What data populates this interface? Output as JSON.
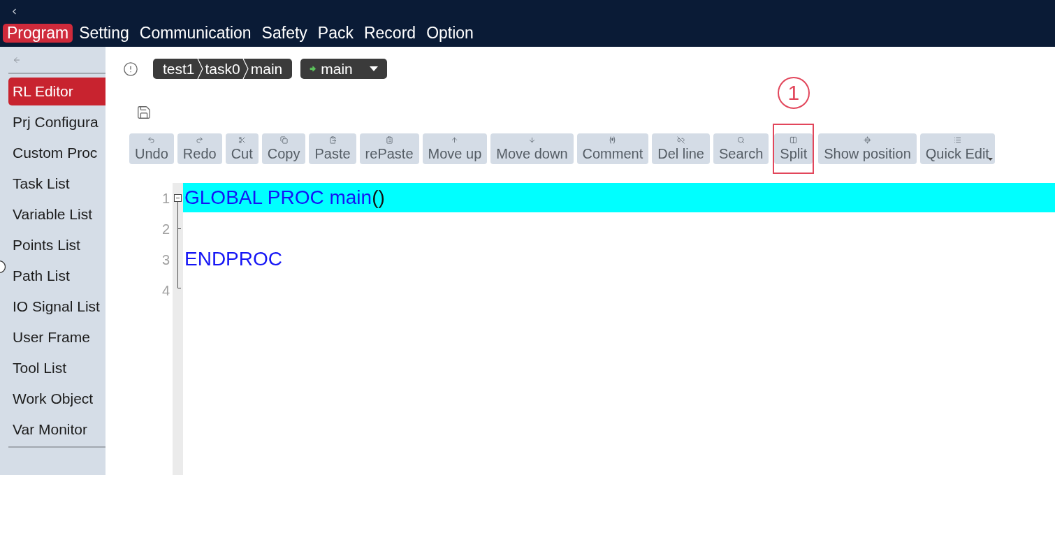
{
  "menu": [
    {
      "label": "Program",
      "selected": true
    },
    {
      "label": "Setting",
      "selected": false
    },
    {
      "label": "Communication",
      "selected": false
    },
    {
      "label": "Safety",
      "selected": false
    },
    {
      "label": "Pack",
      "selected": false
    },
    {
      "label": "Record",
      "selected": false
    },
    {
      "label": "Option",
      "selected": false
    }
  ],
  "sidebar": {
    "items": [
      {
        "label": "RL Editor",
        "selected": true
      },
      {
        "label": "Prj Configura",
        "selected": false
      },
      {
        "label": "Custom Proc",
        "selected": false
      },
      {
        "label": "Task List",
        "selected": false
      },
      {
        "label": "Variable List",
        "selected": false
      },
      {
        "label": "Points List",
        "selected": false
      },
      {
        "label": "Path List",
        "selected": false
      },
      {
        "label": "IO Signal List",
        "selected": false
      },
      {
        "label": "User Frame",
        "selected": false
      },
      {
        "label": "Tool List",
        "selected": false
      },
      {
        "label": "Work Object",
        "selected": false
      },
      {
        "label": "Var Monitor",
        "selected": false
      }
    ]
  },
  "breadcrumb": {
    "segments": [
      "test1",
      "task0",
      "main"
    ]
  },
  "routine_selector": {
    "value": "main"
  },
  "toolbar": [
    {
      "label": "Undo",
      "kind": "undo"
    },
    {
      "label": "Redo",
      "kind": "redo"
    },
    {
      "label": "Cut",
      "kind": "cut"
    },
    {
      "label": "Copy",
      "kind": "copy"
    },
    {
      "label": "Paste",
      "kind": "paste"
    },
    {
      "label": "rePaste",
      "kind": "repaste"
    },
    {
      "label": "Move up",
      "kind": "move-up"
    },
    {
      "label": "Move down",
      "kind": "move-down"
    },
    {
      "label": "Comment",
      "kind": "comment"
    },
    {
      "label": "Del line",
      "kind": "delete-line"
    },
    {
      "label": "Search",
      "kind": "search"
    },
    {
      "label": "Split",
      "kind": "split",
      "callout": "1"
    },
    {
      "label": "Show position",
      "kind": "show-position"
    },
    {
      "label": "Quick Edit",
      "kind": "quick-edit",
      "dropdown": true
    }
  ],
  "editor": {
    "lines": [
      {
        "number": "1",
        "current": true,
        "kind": "fold-start",
        "tokens": [
          {
            "text": "GLOBAL PROC main",
            "kind": "keyword"
          },
          {
            "text": "()",
            "kind": "plain"
          }
        ]
      },
      {
        "number": "2",
        "current": false,
        "kind": "fold-tick"
      },
      {
        "number": "3",
        "current": false,
        "kind": "fold-line",
        "tokens": [
          {
            "text": "ENDPROC",
            "kind": "keyword"
          }
        ]
      },
      {
        "number": "4",
        "current": false,
        "kind": "fold-end"
      }
    ]
  }
}
